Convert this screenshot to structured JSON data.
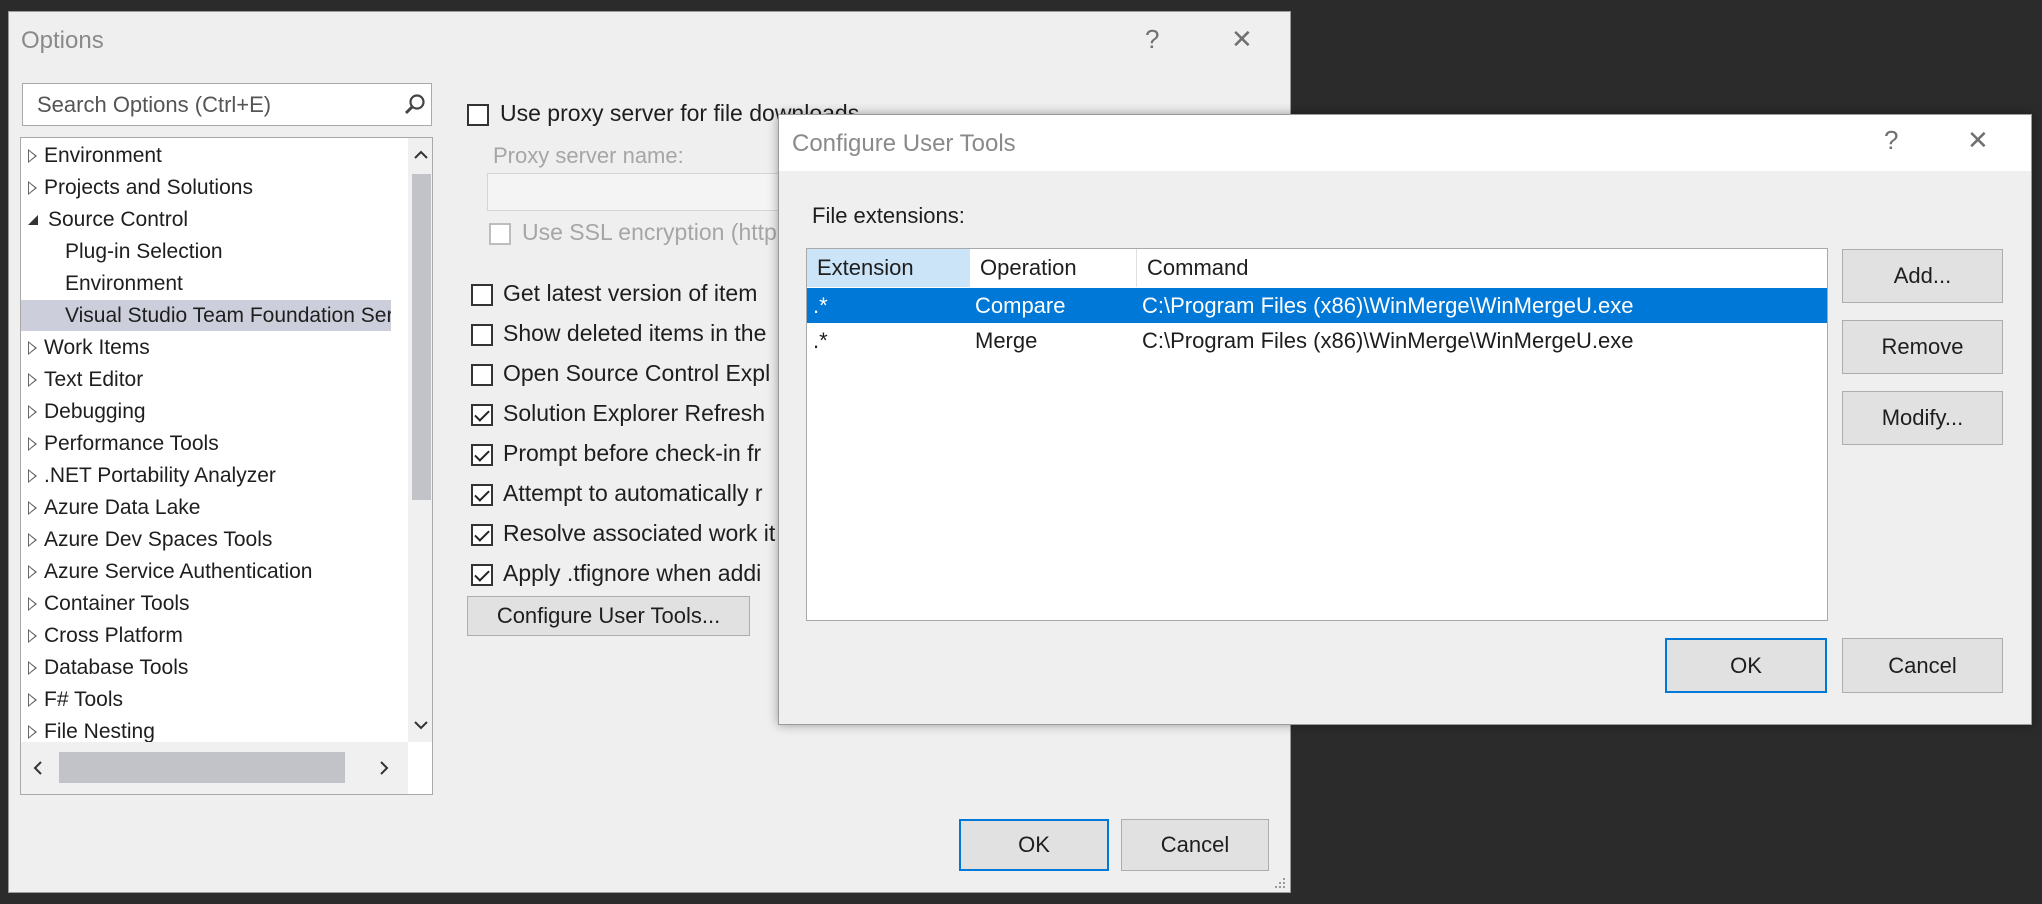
{
  "options_dialog": {
    "title": "Options",
    "help": "?",
    "close": "✕",
    "search_placeholder": "Search Options (Ctrl+E)",
    "tree": [
      {
        "label": "Environment",
        "type": "collapsed"
      },
      {
        "label": "Projects and Solutions",
        "type": "collapsed"
      },
      {
        "label": "Source Control",
        "type": "expanded"
      },
      {
        "label": "Plug-in Selection",
        "type": "child"
      },
      {
        "label": "Environment",
        "type": "child"
      },
      {
        "label": "Visual Studio Team Foundation Serv",
        "type": "child-selected"
      },
      {
        "label": "Work Items",
        "type": "collapsed"
      },
      {
        "label": "Text Editor",
        "type": "collapsed"
      },
      {
        "label": "Debugging",
        "type": "collapsed"
      },
      {
        "label": "Performance Tools",
        "type": "collapsed"
      },
      {
        "label": ".NET Portability Analyzer",
        "type": "collapsed"
      },
      {
        "label": "Azure Data Lake",
        "type": "collapsed"
      },
      {
        "label": "Azure Dev Spaces Tools",
        "type": "collapsed"
      },
      {
        "label": "Azure Service Authentication",
        "type": "collapsed"
      },
      {
        "label": "Container Tools",
        "type": "collapsed"
      },
      {
        "label": "Cross Platform",
        "type": "collapsed"
      },
      {
        "label": "Database Tools",
        "type": "collapsed"
      },
      {
        "label": "F# Tools",
        "type": "collapsed"
      },
      {
        "label": "File Nesting",
        "type": "collapsed"
      }
    ],
    "proxy_checkbox": "Use proxy server for file downloads",
    "proxy_name_label": "Proxy server name:",
    "ssl_label": "Use SSL encryption (http",
    "options": [
      {
        "label": "Get latest version of item",
        "checked": false
      },
      {
        "label": "Show deleted items in the",
        "checked": false
      },
      {
        "label": "Open Source Control Expl",
        "checked": false
      },
      {
        "label": "Solution Explorer Refresh",
        "checked": true
      },
      {
        "label": "Prompt before check-in fr",
        "checked": true
      },
      {
        "label": "Attempt to automatically r",
        "checked": true
      },
      {
        "label": "Resolve associated work it",
        "checked": true
      },
      {
        "label": "Apply .tfignore when addi",
        "checked": true
      }
    ],
    "configure_button": "Configure User Tools...",
    "ok_button": "OK",
    "cancel_button": "Cancel"
  },
  "configure_dialog": {
    "title": "Configure User Tools",
    "help": "?",
    "close": "✕",
    "list_label": "File extensions:",
    "columns": [
      "Extension",
      "Operation",
      "Command"
    ],
    "rows": [
      {
        "extension": ".*",
        "operation": "Compare",
        "command": "C:\\Program Files (x86)\\WinMerge\\WinMergeU.exe",
        "selected": true
      },
      {
        "extension": ".*",
        "operation": "Merge",
        "command": "C:\\Program Files (x86)\\WinMerge\\WinMergeU.exe",
        "selected": false
      }
    ],
    "add_button": "Add...",
    "remove_button": "Remove",
    "modify_button": "Modify...",
    "ok_button": "OK",
    "cancel_button": "Cancel"
  },
  "colors": {
    "selection": "#0078d7",
    "tree_selection": "#cccedb",
    "background": "#2b2b2b"
  }
}
